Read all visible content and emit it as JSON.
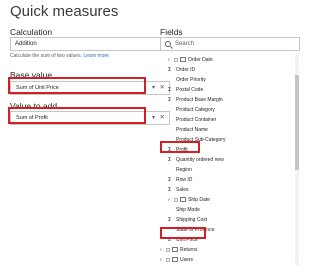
{
  "title": "Quick measures",
  "calculation": {
    "label": "Calculation",
    "value": "Addition",
    "help_text": "Calculate the sum of two values. ",
    "learn_more": "Learn more"
  },
  "base_value": {
    "label": "Base value",
    "value": "Sum of Unit Price"
  },
  "value_to_add": {
    "label": "Value to add",
    "value": "Sum of Profit"
  },
  "fields": {
    "label": "Fields",
    "search_placeholder": "Search",
    "items": [
      {
        "label": "Order Date",
        "icon": "table-icon",
        "kind": "group"
      },
      {
        "label": "Order ID",
        "icon": "sigma-icon",
        "kind": "measure"
      },
      {
        "label": "Order Priority",
        "icon": "",
        "kind": "field"
      },
      {
        "label": "Postal Code",
        "icon": "sigma-icon",
        "kind": "measure"
      },
      {
        "label": "Product Base Margin",
        "icon": "sigma-icon",
        "kind": "measure"
      },
      {
        "label": "Product Category",
        "icon": "",
        "kind": "field"
      },
      {
        "label": "Product Container",
        "icon": "",
        "kind": "field"
      },
      {
        "label": "Product Name",
        "icon": "",
        "kind": "field"
      },
      {
        "label": "Product Sub-Category",
        "icon": "",
        "kind": "field"
      },
      {
        "label": "Profit",
        "icon": "sigma-icon",
        "kind": "measure"
      },
      {
        "label": "Quantity ordered new",
        "icon": "sigma-icon",
        "kind": "measure"
      },
      {
        "label": "Region",
        "icon": "",
        "kind": "field"
      },
      {
        "label": "Row ID",
        "icon": "sigma-icon",
        "kind": "measure"
      },
      {
        "label": "Sales",
        "icon": "sigma-icon",
        "kind": "measure"
      },
      {
        "label": "Ship Date",
        "icon": "table-icon",
        "kind": "group"
      },
      {
        "label": "Ship Mode",
        "icon": "",
        "kind": "field"
      },
      {
        "label": "Shipping Cost",
        "icon": "sigma-icon",
        "kind": "measure"
      },
      {
        "label": "State or Province",
        "icon": "",
        "kind": "field"
      },
      {
        "label": "Unit Price",
        "icon": "sigma-icon",
        "kind": "measure"
      },
      {
        "label": "Returns",
        "icon": "table-icon",
        "kind": "table"
      },
      {
        "label": "Users",
        "icon": "table-icon",
        "kind": "table"
      }
    ]
  },
  "colors": {
    "highlight": "#d21f26",
    "link": "#2b6bb5"
  }
}
